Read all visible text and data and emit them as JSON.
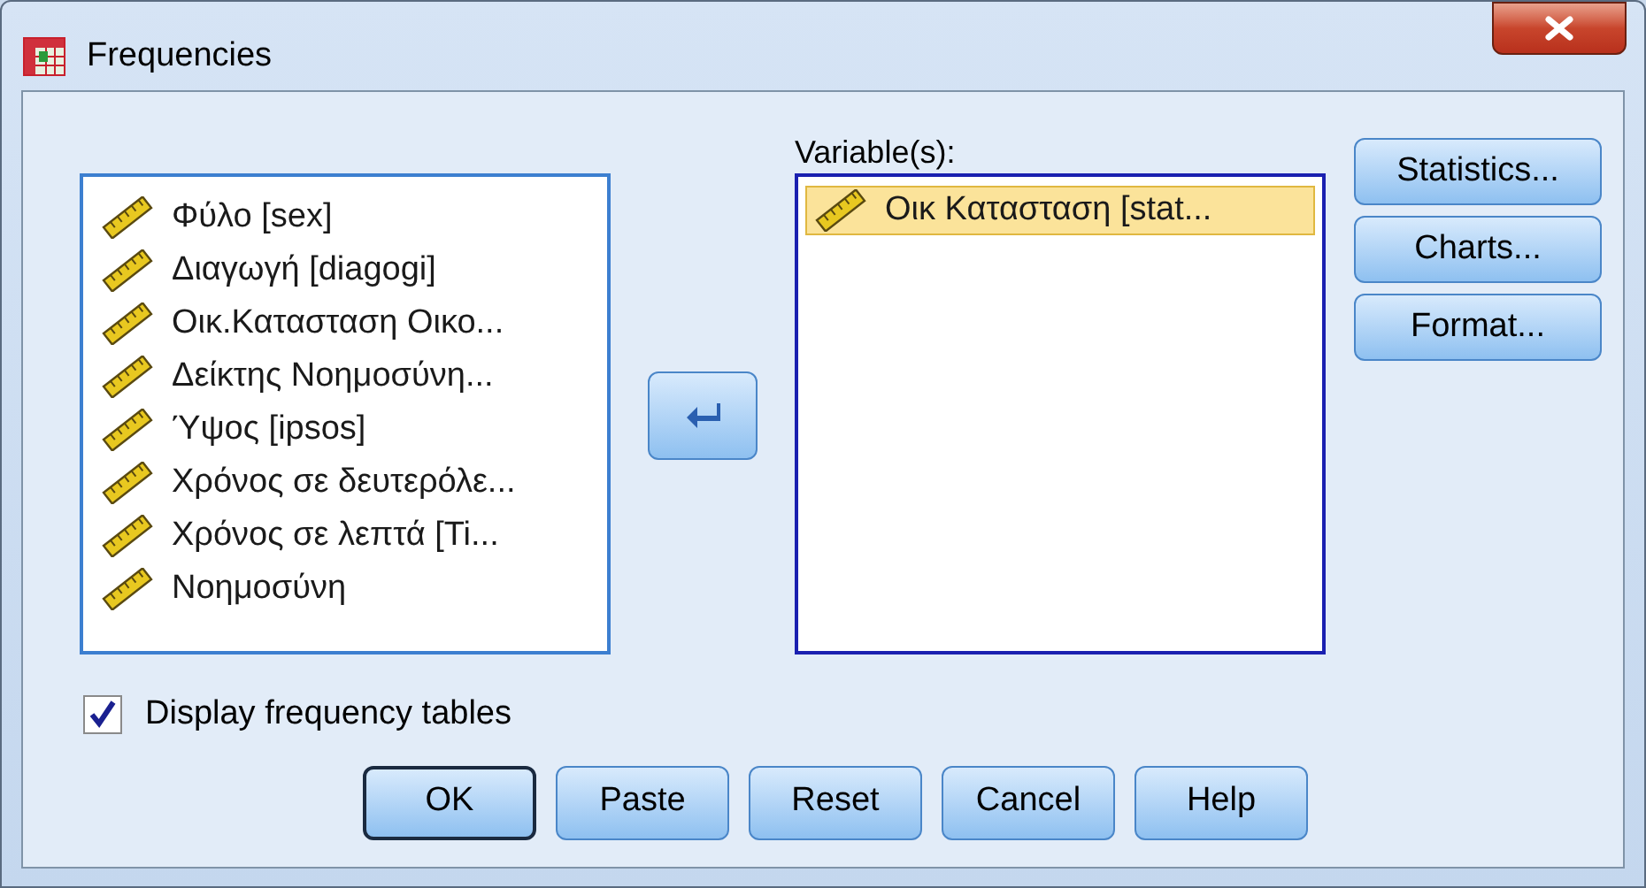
{
  "window": {
    "title": "Frequencies"
  },
  "source_list": {
    "items": [
      {
        "label": "Φύλο [sex]",
        "selected": false
      },
      {
        "label": "Διαγωγή [diagogi]",
        "selected": false
      },
      {
        "label": "Οικ.Κατασταση Οικο...",
        "selected": false
      },
      {
        "label": "Δείκτης Νοημοσύνη...",
        "selected": false
      },
      {
        "label": "Ύψος [ipsos]",
        "selected": false
      },
      {
        "label": "Χρόνος σε δευτερόλε...",
        "selected": false
      },
      {
        "label": "Χρόνος σε λεπτά [Ti...",
        "selected": false
      },
      {
        "label": "Νοημοσύνη",
        "selected": false
      }
    ]
  },
  "variables": {
    "label": "Variable(s):",
    "items": [
      {
        "label": "Οικ Κατασταση [stat...",
        "selected": true
      }
    ]
  },
  "side_buttons": [
    "Statistics...",
    "Charts...",
    "Format..."
  ],
  "display_frequency_tables": {
    "label": "Display frequency tables",
    "checked": true
  },
  "buttons": [
    {
      "label": "OK",
      "default": true
    },
    {
      "label": "Paste",
      "default": false
    },
    {
      "label": "Reset",
      "default": false
    },
    {
      "label": "Cancel",
      "default": false
    },
    {
      "label": "Help",
      "default": false
    }
  ]
}
